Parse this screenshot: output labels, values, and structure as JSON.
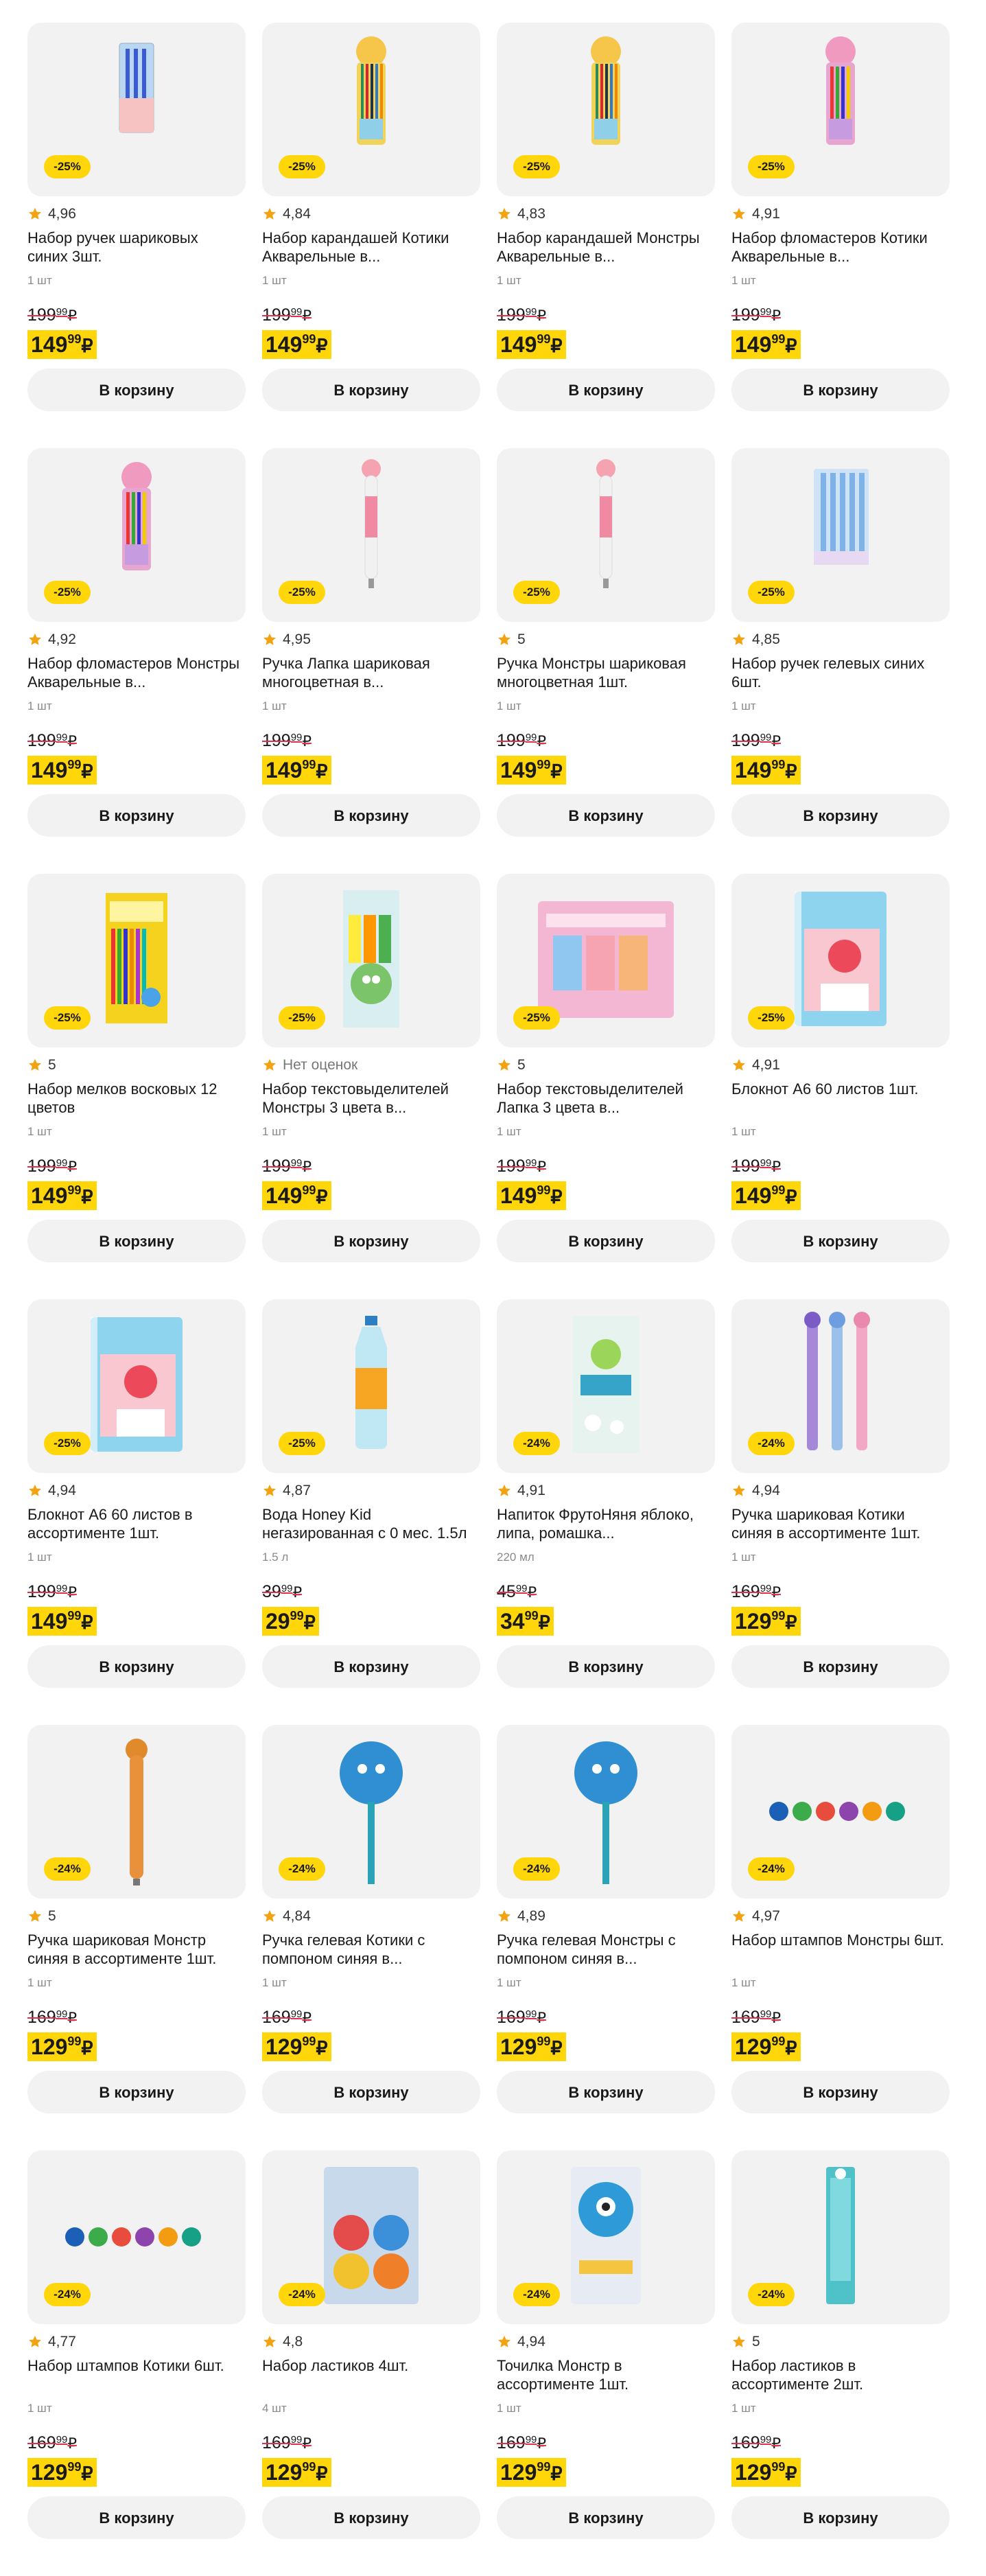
{
  "button_label": "В корзину",
  "currency": "₽",
  "colors": {
    "accent": "#ffd60a",
    "star": "#f3a312",
    "strike": "#e0304a"
  },
  "products": [
    {
      "discount": "-25%",
      "rating": "4,96",
      "title": "Набор ручек шариковых синих 3шт.",
      "unit": "1 шт",
      "old_int": "199",
      "old_frac": "99",
      "cur_int": "149",
      "cur_frac": "99",
      "icon": "pens-pack-icon"
    },
    {
      "discount": "-25%",
      "rating": "4,84",
      "title": "Набор карандашей Котики Акварельные в...",
      "unit": "1 шт",
      "old_int": "199",
      "old_frac": "99",
      "cur_int": "149",
      "cur_frac": "99",
      "icon": "pencil-tube-icon"
    },
    {
      "discount": "-25%",
      "rating": "4,83",
      "title": "Набор карандашей Монстры Акварельные в...",
      "unit": "1 шт",
      "old_int": "199",
      "old_frac": "99",
      "cur_int": "149",
      "cur_frac": "99",
      "icon": "pencil-tube-icon"
    },
    {
      "discount": "-25%",
      "rating": "4,91",
      "title": "Набор фломастеров Котики Акварельные в...",
      "unit": "1 шт",
      "old_int": "199",
      "old_frac": "99",
      "cur_int": "149",
      "cur_frac": "99",
      "icon": "marker-tube-icon"
    },
    {
      "discount": "-25%",
      "rating": "4,92",
      "title": "Набор фломастеров Монстры Акварельные в...",
      "unit": "1 шт",
      "old_int": "199",
      "old_frac": "99",
      "cur_int": "149",
      "cur_frac": "99",
      "icon": "marker-tube-icon"
    },
    {
      "discount": "-25%",
      "rating": "4,95",
      "title": "Ручка Лапка шариковая многоцветная в...",
      "unit": "1 шт",
      "old_int": "199",
      "old_frac": "99",
      "cur_int": "149",
      "cur_frac": "99",
      "icon": "multicolor-pen-icon"
    },
    {
      "discount": "-25%",
      "rating": "5",
      "title": "Ручка Монстры шариковая многоцветная 1шт.",
      "unit": "1 шт",
      "old_int": "199",
      "old_frac": "99",
      "cur_int": "149",
      "cur_frac": "99",
      "icon": "multicolor-pen-icon"
    },
    {
      "discount": "-25%",
      "rating": "4,85",
      "title": "Набор ручек гелевых синих 6шт.",
      "unit": "1 шт",
      "old_int": "199",
      "old_frac": "99",
      "cur_int": "149",
      "cur_frac": "99",
      "icon": "gel-pens-icon"
    },
    {
      "discount": "-25%",
      "rating": "5",
      "title": "Набор мелков восковых 12 цветов",
      "unit": "1 шт",
      "old_int": "199",
      "old_frac": "99",
      "cur_int": "149",
      "cur_frac": "99",
      "icon": "crayons-box-icon"
    },
    {
      "discount": "-25%",
      "rating": "Нет оценок",
      "no_rating": true,
      "title": "Набор текстовыделителей Монстры 3 цвета в...",
      "unit": "1 шт",
      "old_int": "199",
      "old_frac": "99",
      "cur_int": "149",
      "cur_frac": "99",
      "icon": "highlighters-icon"
    },
    {
      "discount": "-25%",
      "rating": "5",
      "title": "Набор текстовыделителей Лапка 3 цвета в...",
      "unit": "1 шт",
      "old_int": "199",
      "old_frac": "99",
      "cur_int": "149",
      "cur_frac": "99",
      "icon": "highlighters-box-icon"
    },
    {
      "discount": "-25%",
      "rating": "4,91",
      "title": "Блокнот А6 60 листов 1шт.",
      "unit": "1 шт",
      "old_int": "199",
      "old_frac": "99",
      "cur_int": "149",
      "cur_frac": "99",
      "icon": "notebook-icon"
    },
    {
      "discount": "-25%",
      "rating": "4,94",
      "title": "Блокнот А6 60 листов в ассортименте 1шт.",
      "unit": "1 шт",
      "old_int": "199",
      "old_frac": "99",
      "cur_int": "149",
      "cur_frac": "99",
      "icon": "notebook-icon"
    },
    {
      "discount": "-25%",
      "rating": "4,87",
      "title": "Вода Honey Kid негазированная с 0 мес. 1.5л",
      "unit": "1.5 л",
      "old_int": "39",
      "old_frac": "99",
      "cur_int": "29",
      "cur_frac": "99",
      "icon": "water-bottle-icon"
    },
    {
      "discount": "-24%",
      "rating": "4,91",
      "title": "Напиток ФрутоНяня яблоко, липа, ромашка...",
      "unit": "220 мл",
      "old_int": "45",
      "old_frac": "99",
      "cur_int": "34",
      "cur_frac": "99",
      "icon": "juice-box-icon"
    },
    {
      "discount": "-24%",
      "rating": "4,94",
      "title": "Ручка шариковая Котики синяя в ассортименте 1шт.",
      "unit": "1 шт",
      "old_int": "169",
      "old_frac": "99",
      "cur_int": "129",
      "cur_frac": "99",
      "icon": "cat-pens-icon"
    },
    {
      "discount": "-24%",
      "rating": "5",
      "title": "Ручка шариковая Монстр синяя в ассортименте 1шт.",
      "unit": "1 шт",
      "old_int": "169",
      "old_frac": "99",
      "cur_int": "129",
      "cur_frac": "99",
      "icon": "monster-pen-icon"
    },
    {
      "discount": "-24%",
      "rating": "4,84",
      "title": "Ручка гелевая Котики с помпоном синяя в...",
      "unit": "1 шт",
      "old_int": "169",
      "old_frac": "99",
      "cur_int": "129",
      "cur_frac": "99",
      "icon": "pompom-pen-icon"
    },
    {
      "discount": "-24%",
      "rating": "4,89",
      "title": "Ручка гелевая Монстры с помпоном синяя в...",
      "unit": "1 шт",
      "old_int": "169",
      "old_frac": "99",
      "cur_int": "129",
      "cur_frac": "99",
      "icon": "pompom-pen-icon"
    },
    {
      "discount": "-24%",
      "rating": "4,97",
      "title": "Набор штампов Монстры 6шт.",
      "unit": "1 шт",
      "old_int": "169",
      "old_frac": "99",
      "cur_int": "129",
      "cur_frac": "99",
      "icon": "stamps-icon"
    },
    {
      "discount": "-24%",
      "rating": "4,77",
      "title": "Набор штампов Котики 6шт.",
      "unit": "1 шт",
      "old_int": "169",
      "old_frac": "99",
      "cur_int": "129",
      "cur_frac": "99",
      "icon": "stamps-icon"
    },
    {
      "discount": "-24%",
      "rating": "4,8",
      "title": "Набор ластиков 4шт.",
      "unit": "4 шт",
      "old_int": "169",
      "old_frac": "99",
      "cur_int": "129",
      "cur_frac": "99",
      "icon": "erasers-icon"
    },
    {
      "discount": "-24%",
      "rating": "4,94",
      "title": "Точилка Монстр в ассортименте 1шт.",
      "unit": "1 шт",
      "old_int": "169",
      "old_frac": "99",
      "cur_int": "129",
      "cur_frac": "99",
      "icon": "sharpener-icon"
    },
    {
      "discount": "-24%",
      "rating": "5",
      "title": "Набор ластиков в ассортименте 2шт.",
      "unit": "1 шт",
      "old_int": "169",
      "old_frac": "99",
      "cur_int": "129",
      "cur_frac": "99",
      "icon": "eraser-pack-icon"
    }
  ]
}
